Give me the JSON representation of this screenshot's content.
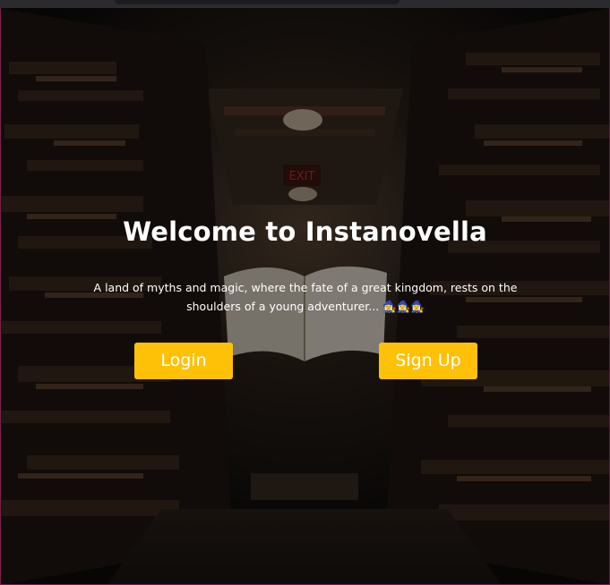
{
  "hero": {
    "title": "Welcome to Instanovella",
    "subtitle": "A land of myths and magic, where the fate of a great kingdom, rests on the shoulders of a young adventurer... 🧙‍♀️🧙‍♀️🧙‍♀️"
  },
  "buttons": {
    "login_label": "Login",
    "signup_label": "Sign Up"
  },
  "background": {
    "exit_sign_text": "EXIT"
  },
  "colors": {
    "accent": "#ffc107",
    "text": "#ffffff",
    "frame_edge": "#7a1f4a"
  }
}
